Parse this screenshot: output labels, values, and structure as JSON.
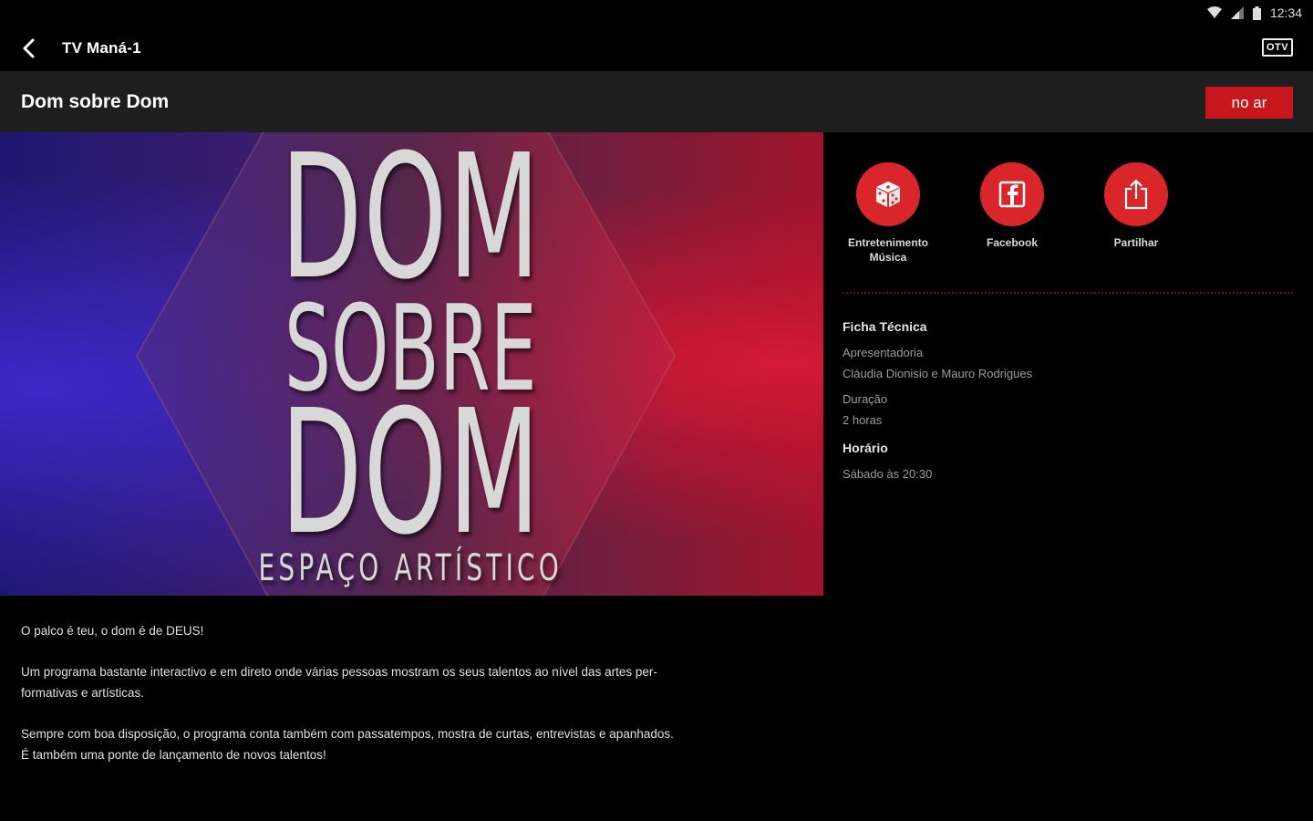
{
  "status_bar": {
    "time": "12:34",
    "icons": [
      "wifi-icon",
      "signal-icon",
      "battery-icon"
    ]
  },
  "app_bar": {
    "back_icon": "chevron-left-icon",
    "title": "TV Maná-1",
    "channel_logo": "OTV"
  },
  "program": {
    "title": "Dom sobre Dom",
    "live_badge": "no ar"
  },
  "hero": {
    "line1": "DOM",
    "line2": "SOBRE",
    "line3": "DOM",
    "line4": "ESPAÇO ARTÍSTICO"
  },
  "actions": [
    {
      "icon": "dice-icon",
      "label_line1": "Entretenimento",
      "label_line2": "Música"
    },
    {
      "icon": "facebook-icon",
      "label_line1": "Facebook",
      "label_line2": ""
    },
    {
      "icon": "share-icon",
      "label_line1": "Partilhar",
      "label_line2": ""
    }
  ],
  "info": {
    "ficha_heading": "Ficha Técnica",
    "presenter_label": "Apresentadoria",
    "presenter_value": "Cláudia Dionisio e Mauro Rodrigues",
    "duration_label": "Duração",
    "duration_value": "2 horas",
    "schedule_heading": "Horário",
    "schedule_value": "Sábado às 20:30"
  },
  "description": {
    "p1": "O palco é teu, o dom é de DEUS!",
    "p2_line1": "Um programa bastante interactivo e em direto onde várias pessoas mostram os seus talentos ao nível das artes per-",
    "p2_line2": "formativas e artísticas.",
    "p3_line1": "Sempre com boa disposição, o programa conta também com passatempos, mostra de curtas, entrevistas e apanhados.",
    "p3_line2": "É também uma ponte de lançamento de novos talentos!"
  },
  "colors": {
    "accent": "#d8262b",
    "live_badge": "#c8161d",
    "header_bg": "#1e1e1e",
    "background": "#000000"
  }
}
